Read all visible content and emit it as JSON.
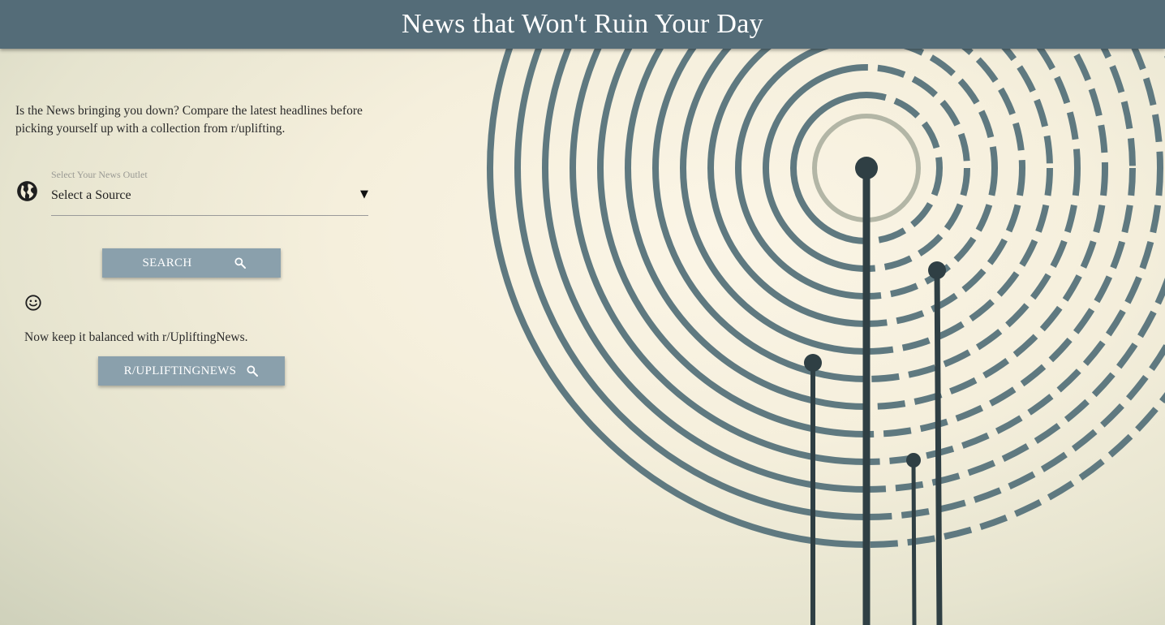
{
  "header": {
    "title": "News that Won't Ruin Your Day"
  },
  "intro": {
    "text": "Is the News bringing you down? Compare the latest headlines before picking yourself up with a collection from r/uplifting."
  },
  "source_select": {
    "label": "Select Your News Outlet",
    "value": "Select a Source",
    "arrow": "▼"
  },
  "search_button": {
    "label": "SEARCH",
    "icon": "search-icon"
  },
  "uplifting": {
    "text": "Now keep it balanced with r/UpliftingNews.",
    "button_label": "R/UPLIFTINGNEWS",
    "icon": "search-icon"
  },
  "icons": {
    "globe": "globe-icon",
    "smiley": "smiley-icon"
  },
  "colors": {
    "header_bg": "#546c78",
    "button_bg": "#8aa0ac",
    "art_stroke": "#5f7980",
    "background": "#f5efdc"
  }
}
